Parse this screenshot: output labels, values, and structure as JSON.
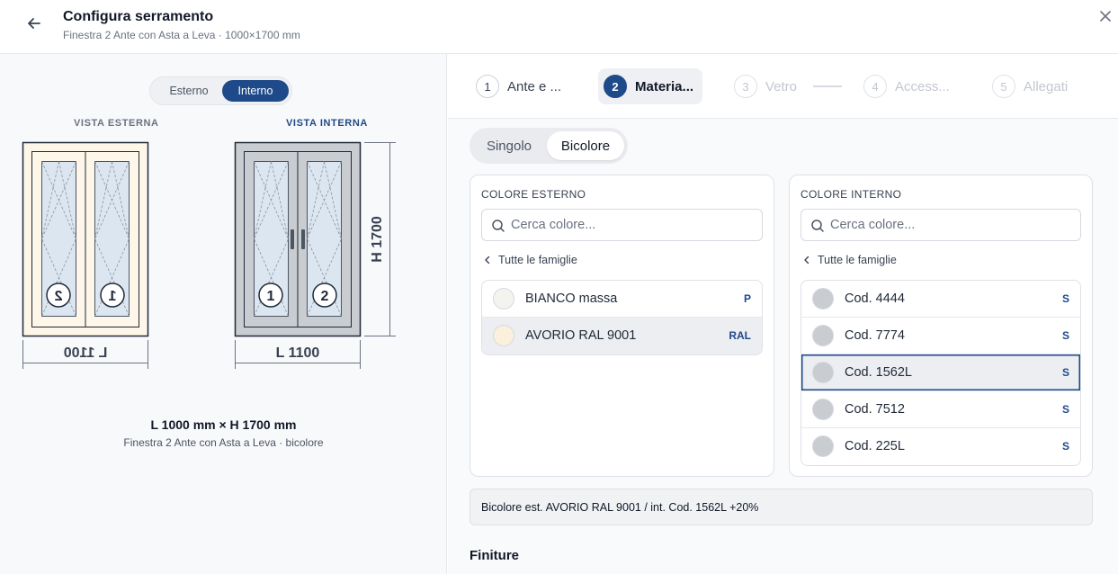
{
  "header": {
    "title": "Configura serramento",
    "subtitle": "Finestra 2 Ante con Asta a Leva · 1000×1700 mm"
  },
  "left": {
    "toggle": {
      "esterno": "Esterno",
      "interno": "Interno",
      "selected": "Interno"
    },
    "label_external": "VISTA ESTERNA",
    "label_internal": "VISTA INTERNA",
    "ext_width_label": "L 1100",
    "int_width_label": "L 1100",
    "height_label": "H 1700",
    "sash_numbers": [
      "1",
      "2"
    ],
    "dimensions": "L 1000 mm × H 1700 mm",
    "description": "Finestra 2 Ante con Asta a Leva · bicolore",
    "colors": {
      "external_frame": "#fdf6e9",
      "internal_frame": "#c9ccd0",
      "glass": "#dce6f0"
    }
  },
  "stepper": [
    {
      "num": "1",
      "label": "Ante e ...",
      "state": "done"
    },
    {
      "num": "2",
      "label": "Materia...",
      "state": "active"
    },
    {
      "num": "3",
      "label": "Vetro",
      "state": "disabled"
    },
    {
      "num": "4",
      "label": "Access...",
      "state": "disabled"
    },
    {
      "num": "5",
      "label": "Allegati",
      "state": "disabled"
    }
  ],
  "mode": {
    "singolo": "Singolo",
    "bicolore": "Bicolore",
    "selected": "Bicolore"
  },
  "external": {
    "title": "COLORE ESTERNO",
    "placeholder": "Cerca colore...",
    "back": "Tutte le famiglie",
    "items": [
      {
        "name": "BIANCO massa",
        "badge": "P",
        "swatch": "#f3f4ee"
      },
      {
        "name": "AVORIO RAL 9001",
        "badge": "RAL",
        "swatch": "#fbf0dc"
      }
    ]
  },
  "internal": {
    "title": "COLORE INTERNO",
    "placeholder": "Cerca colore...",
    "back": "Tutte le famiglie",
    "items": [
      {
        "name": "Cod. 4444",
        "badge": "S",
        "swatch": "#c9ccd0"
      },
      {
        "name": "Cod. 7774",
        "badge": "S",
        "swatch": "#c9ccd0"
      },
      {
        "name": "Cod. 1562L",
        "badge": "S",
        "swatch": "#c9ccd0"
      },
      {
        "name": "Cod. 7512",
        "badge": "S",
        "swatch": "#c9ccd0"
      },
      {
        "name": "Cod. 225L",
        "badge": "S",
        "swatch": "#c9ccd0"
      }
    ]
  },
  "summary": "Bicolore est. AVORIO RAL 9001 / int. Cod. 1562L +20%",
  "section_next": "Finiture",
  "accent": "#1e4a8a"
}
